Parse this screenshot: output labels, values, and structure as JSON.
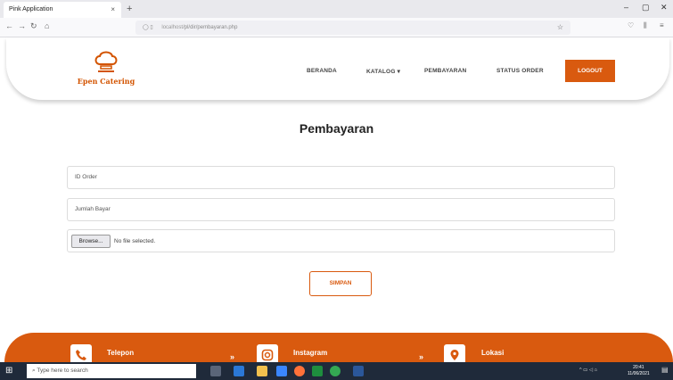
{
  "browser": {
    "tab_title": "Pink Application",
    "tab_close": "×",
    "new_tab": "+",
    "url_prefix": "localhost",
    "url_path": "/pl/dir/pembayaran.php",
    "minimize": "–",
    "maximize": "▢",
    "close": "✕"
  },
  "site": {
    "brand": "Epen Catering",
    "brand_color": "#d35400",
    "accent_color": "#d95a0f",
    "nav": [
      {
        "label": "BERANDA"
      },
      {
        "label": "KATALOG ▾"
      },
      {
        "label": "PEMBAYARAN"
      },
      {
        "label": "STATUS ORDER"
      }
    ],
    "logout_label": "LOGOUT"
  },
  "main": {
    "title": "Pembayaran",
    "id_order_placeholder": "ID Order",
    "jumlah_bayar_placeholder": "Jumlah Bayar",
    "browse_label": "Browse...",
    "file_status": "No file selected.",
    "submit_label": "SIMPAN"
  },
  "footer": {
    "items": [
      {
        "label": "Telepon",
        "icon": "phone-icon"
      },
      {
        "label": "Instagram",
        "icon": "instagram-icon"
      },
      {
        "label": "Lokasi",
        "icon": "location-icon"
      }
    ]
  },
  "taskbar": {
    "search_placeholder": "Type here to search",
    "time": "20:41",
    "date": "11/06/2021"
  }
}
